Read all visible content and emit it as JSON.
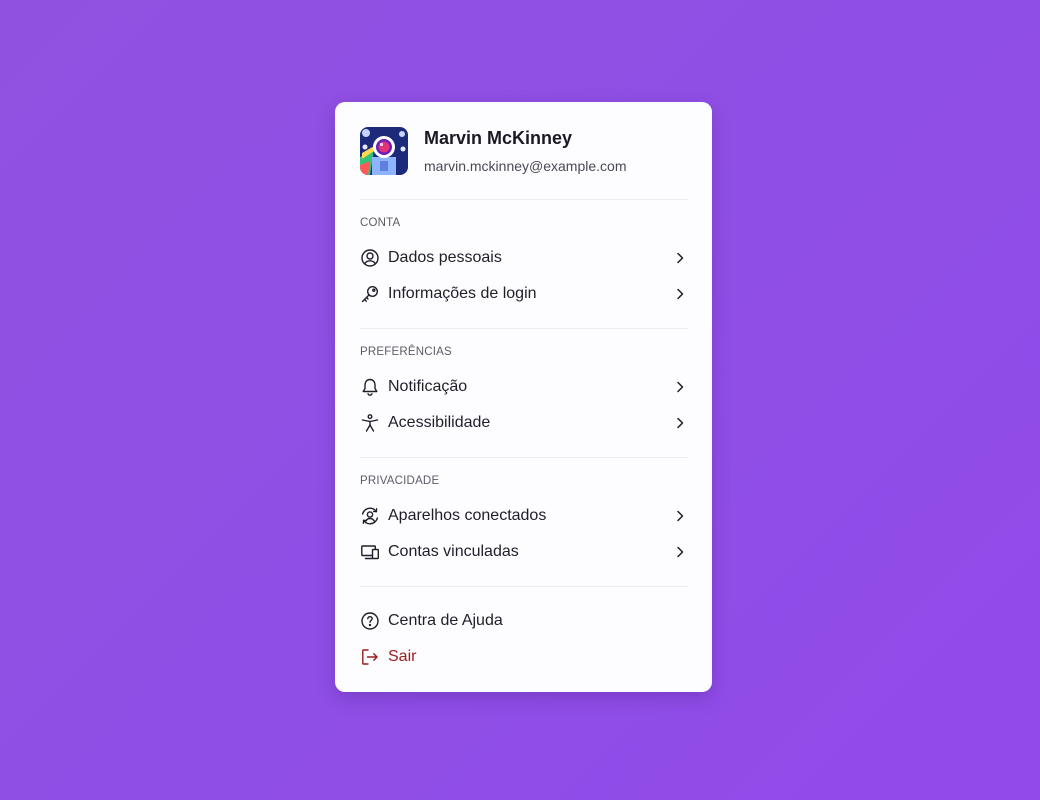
{
  "profile": {
    "name": "Marvin McKinney",
    "email": "marvin.mckinney@example.com",
    "avatar_icon": "astronaut-avatar"
  },
  "sections": {
    "account": {
      "title": "CONTA",
      "items": [
        {
          "label": "Dados pessoais",
          "icon": "user-circle-icon"
        },
        {
          "label": "Informações de login",
          "icon": "key-icon"
        }
      ]
    },
    "preferences": {
      "title": "PREFERÊNCIAS",
      "items": [
        {
          "label": "Notificação",
          "icon": "bell-icon"
        },
        {
          "label": "Acessibilidade",
          "icon": "accessibility-icon"
        }
      ]
    },
    "privacy": {
      "title": "PRIVACIDADE",
      "items": [
        {
          "label": "Aparelhos conectados",
          "icon": "user-sync-icon"
        },
        {
          "label": "Contas vinculadas",
          "icon": "devices-icon"
        }
      ]
    }
  },
  "footer": {
    "items": [
      {
        "label": "Centra de Ajuda",
        "icon": "help-circle-icon"
      },
      {
        "label": "Sair",
        "icon": "logout-icon",
        "color": "#9b1c1c"
      }
    ]
  },
  "colors": {
    "background": "#9151e0",
    "card": "#fdfcff",
    "text": "#1f1f2a",
    "danger": "#9b1c1c"
  }
}
